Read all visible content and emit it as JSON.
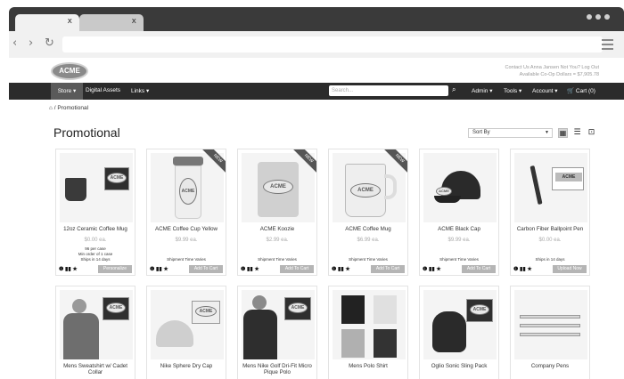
{
  "browser": {
    "tabs": [
      {
        "close": "x"
      },
      {
        "close": "x"
      }
    ]
  },
  "site": {
    "logo_text": "ACME",
    "contact_line": "Contact Us  Anna Jansen Not You? Log Out",
    "dollars_line": "Available Co-Op Dollars = $7,905.78"
  },
  "nav": {
    "store": "Store",
    "digital_assets": "Digital Assets",
    "links": "Links",
    "search_placeholder": "Search...",
    "admin": "Admin",
    "tools": "Tools",
    "account": "Account",
    "cart": "Cart (0)"
  },
  "breadcrumb": {
    "current": "Promotional"
  },
  "page": {
    "title": "Promotional",
    "sort_label": "Sort By"
  },
  "products": [
    {
      "name": "12oz Ceramic Coffee Mug",
      "price": "$0.00 ea.",
      "detail": "96 per case\nMin order of 1 case\nShips in 14 days",
      "ship": "",
      "cta": "Personalize",
      "new": false
    },
    {
      "name": "ACME Coffee Cup Yellow",
      "price": "$9.99 ea.",
      "detail": "",
      "ship": "Shipment Time Varies",
      "cta": "Add To Cart",
      "new": true,
      "ribbon": "NEW"
    },
    {
      "name": "ACME Koozie",
      "price": "$2.99 ea.",
      "detail": "",
      "ship": "Shipment Time Varies",
      "cta": "Add To Cart",
      "new": true,
      "ribbon": "NEW"
    },
    {
      "name": "ACME Coffee Mug",
      "price": "$6.99 ea.",
      "detail": "",
      "ship": "Shipment Time Varies",
      "cta": "Add To Cart",
      "new": true,
      "ribbon": "NEW"
    },
    {
      "name": "ACME Black Cap",
      "price": "$9.99 ea.",
      "detail": "",
      "ship": "Shipment Time Varies",
      "cta": "Add To Cart",
      "new": false
    },
    {
      "name": "Carbon Fiber Ballpoint Pen",
      "price": "$0.00 ea.",
      "detail": "",
      "ship": "Ships in 14 days",
      "cta": "Upload Now",
      "new": false
    },
    {
      "name": "Mens Sweatshirt w/ Cadet Collar",
      "price": "",
      "new": false
    },
    {
      "name": "Nike Sphere Dry Cap",
      "price": "",
      "new": false
    },
    {
      "name": "Mens Nike Golf Dri-Fit Micro Pique Polo",
      "price": "",
      "new": false
    },
    {
      "name": "Mens Polo Shirt",
      "price": "",
      "new": false
    },
    {
      "name": "Oglio Sonic Sling Pack",
      "price": "",
      "new": false
    },
    {
      "name": "Company Pens",
      "price": "",
      "new": false
    }
  ],
  "card_icons": "❶ ▮▮ ★",
  "colors": {
    "navbar": "#2b2b2b",
    "store_active": "#5a5a5a",
    "button": "#b5b5b5",
    "chrome_dark": "#3a3a3a"
  }
}
